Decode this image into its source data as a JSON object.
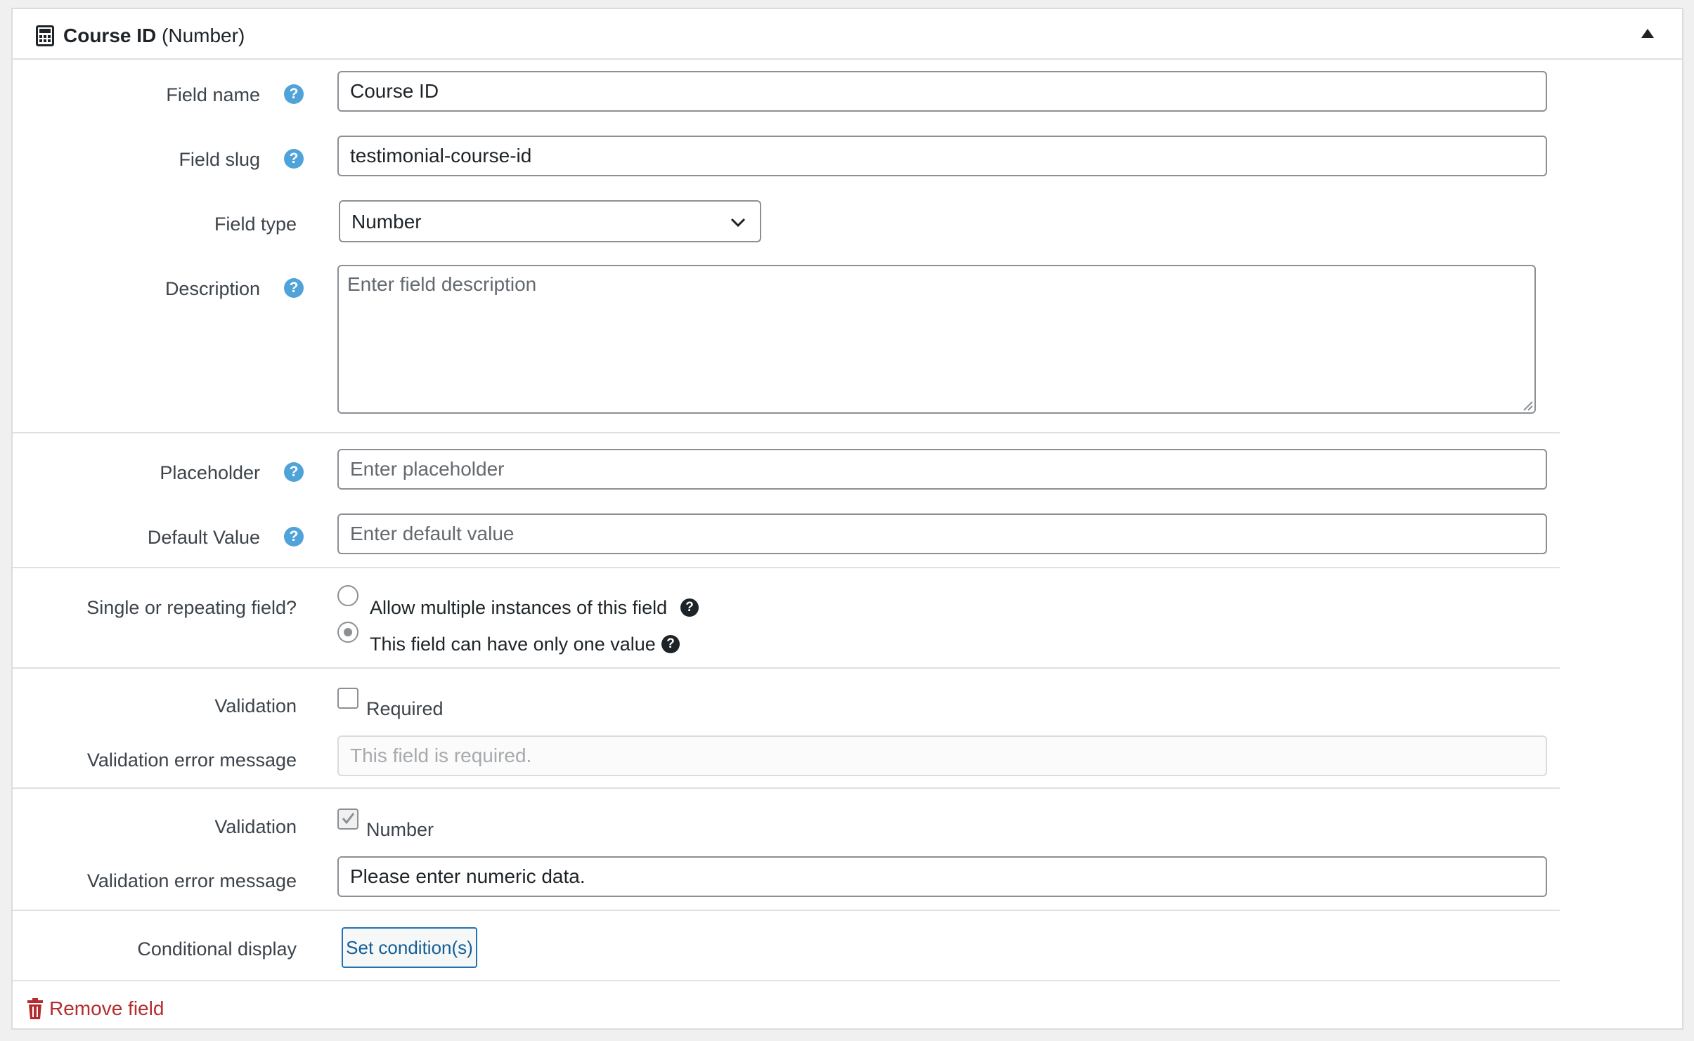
{
  "header": {
    "field_title": "Course ID",
    "field_type_suffix": "(Number)",
    "icon": "calculator-icon",
    "toggle_icon": "triangle-up-icon"
  },
  "fields": {
    "field_name": {
      "label": "Field name",
      "value": "Course ID",
      "help": "?"
    },
    "field_slug": {
      "label": "Field slug",
      "value": "testimonial-course-id",
      "help": "?"
    },
    "field_type": {
      "label": "Field type",
      "selected": "Number"
    },
    "description": {
      "label": "Description",
      "placeholder": "Enter field description",
      "help": "?"
    },
    "placeholder": {
      "label": "Placeholder",
      "placeholder": "Enter placeholder",
      "help": "?"
    },
    "default_value": {
      "label": "Default Value",
      "placeholder": "Enter default value",
      "help": "?"
    }
  },
  "repeating": {
    "label": "Single or repeating field?",
    "options": [
      {
        "label": "Allow multiple instances of this field",
        "selected": false
      },
      {
        "label": "This field can have only one value",
        "selected": true
      }
    ],
    "help": "?"
  },
  "validation_required": {
    "label": "Validation",
    "checkbox_label": "Required",
    "checked": false,
    "error_label": "Validation error message",
    "error_placeholder": "This field is required."
  },
  "validation_number": {
    "label": "Validation",
    "checkbox_label": "Number",
    "checked": true,
    "error_label": "Validation error message",
    "error_value": "Please enter numeric data."
  },
  "conditional": {
    "label": "Conditional display",
    "button": "Set condition(s)"
  },
  "remove": {
    "label": "Remove field",
    "icon": "trash-icon",
    "color": "#b32d2e"
  },
  "colors": {
    "help_blue": "#4fa3d8",
    "button_blue": "#2271b1"
  }
}
